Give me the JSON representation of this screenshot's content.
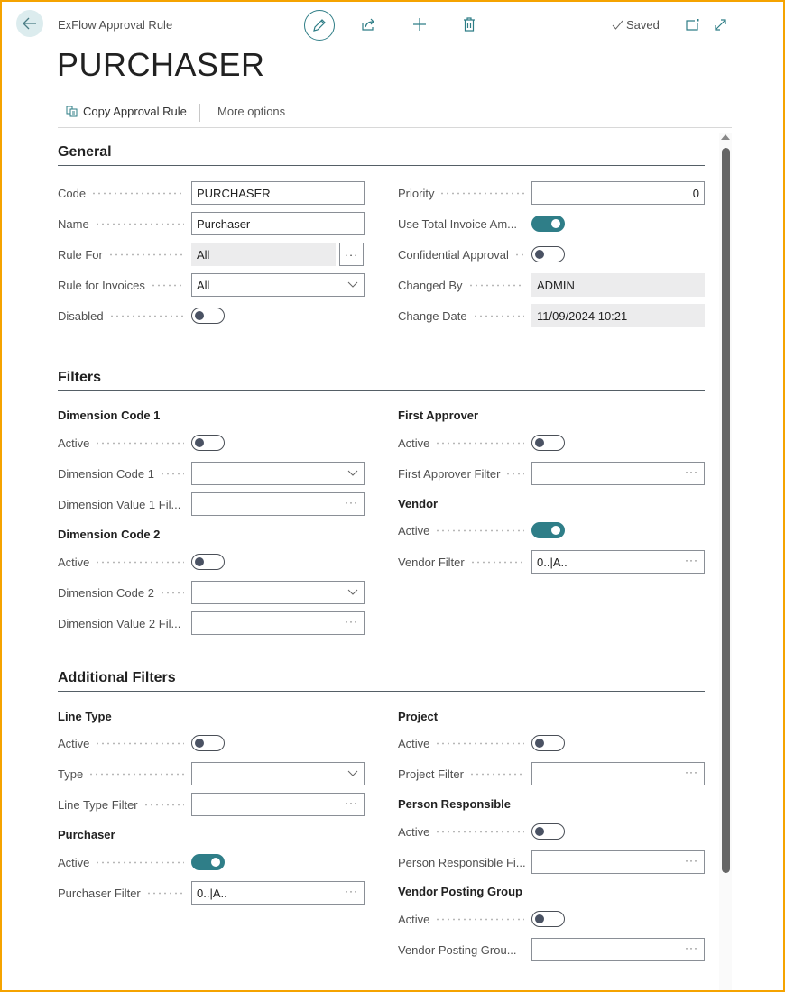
{
  "header": {
    "caption": "ExFlow Approval Rule",
    "title": "PURCHASER",
    "status": "Saved",
    "icons": [
      "back-arrow-icon",
      "pencil-icon",
      "share-icon",
      "plus-icon",
      "trash-icon",
      "checkmark-icon",
      "open-new-window-icon",
      "expand-icon"
    ]
  },
  "actions": {
    "copy_label": "Copy Approval Rule",
    "more_label": "More options"
  },
  "colors": {
    "accent": "#2f7e88",
    "frame": "#f5a300"
  },
  "general": {
    "title": "General",
    "code": {
      "label": "Code",
      "value": "PURCHASER"
    },
    "name": {
      "label": "Name",
      "value": "Purchaser"
    },
    "rule_for": {
      "label": "Rule For",
      "value": "All"
    },
    "rule_for_invoices": {
      "label": "Rule for Invoices",
      "value": "All"
    },
    "disabled": {
      "label": "Disabled",
      "on": false
    },
    "priority": {
      "label": "Priority",
      "value": "0"
    },
    "use_total": {
      "label": "Use Total Invoice Am...",
      "on": true
    },
    "confidential": {
      "label": "Confidential Approval",
      "on": false
    },
    "changed_by": {
      "label": "Changed By",
      "value": "ADMIN"
    },
    "change_date": {
      "label": "Change Date",
      "value": "11/09/2024 10:21"
    }
  },
  "filters": {
    "title": "Filters",
    "dim1": {
      "title": "Dimension Code 1",
      "active": {
        "label": "Active",
        "on": false
      },
      "code": {
        "label": "Dimension Code 1",
        "value": ""
      },
      "value_filter": {
        "label": "Dimension Value 1 Fil...",
        "value": ""
      }
    },
    "dim2": {
      "title": "Dimension Code 2",
      "active": {
        "label": "Active",
        "on": false
      },
      "code": {
        "label": "Dimension Code 2",
        "value": ""
      },
      "value_filter": {
        "label": "Dimension Value 2 Fil...",
        "value": ""
      }
    },
    "first_approver": {
      "title": "First Approver",
      "active": {
        "label": "Active",
        "on": false
      },
      "filter": {
        "label": "First Approver Filter",
        "value": ""
      }
    },
    "vendor": {
      "title": "Vendor",
      "active": {
        "label": "Active",
        "on": true
      },
      "filter": {
        "label": "Vendor Filter",
        "value": "0..|A.."
      }
    }
  },
  "additional": {
    "title": "Additional Filters",
    "line_type": {
      "title": "Line Type",
      "active": {
        "label": "Active",
        "on": false
      },
      "type": {
        "label": "Type",
        "value": ""
      },
      "filter": {
        "label": "Line Type Filter",
        "value": ""
      }
    },
    "purchaser": {
      "title": "Purchaser",
      "active": {
        "label": "Active",
        "on": true
      },
      "filter": {
        "label": "Purchaser Filter",
        "value": "0..|A.."
      }
    },
    "project": {
      "title": "Project",
      "active": {
        "label": "Active",
        "on": false
      },
      "filter": {
        "label": "Project Filter",
        "value": ""
      }
    },
    "person": {
      "title": "Person Responsible",
      "active": {
        "label": "Active",
        "on": false
      },
      "filter": {
        "label": "Person Responsible Fi...",
        "value": ""
      }
    },
    "vpg": {
      "title": "Vendor Posting Group",
      "active": {
        "label": "Active",
        "on": false
      },
      "filter": {
        "label": "Vendor Posting Grou...",
        "value": ""
      }
    }
  }
}
